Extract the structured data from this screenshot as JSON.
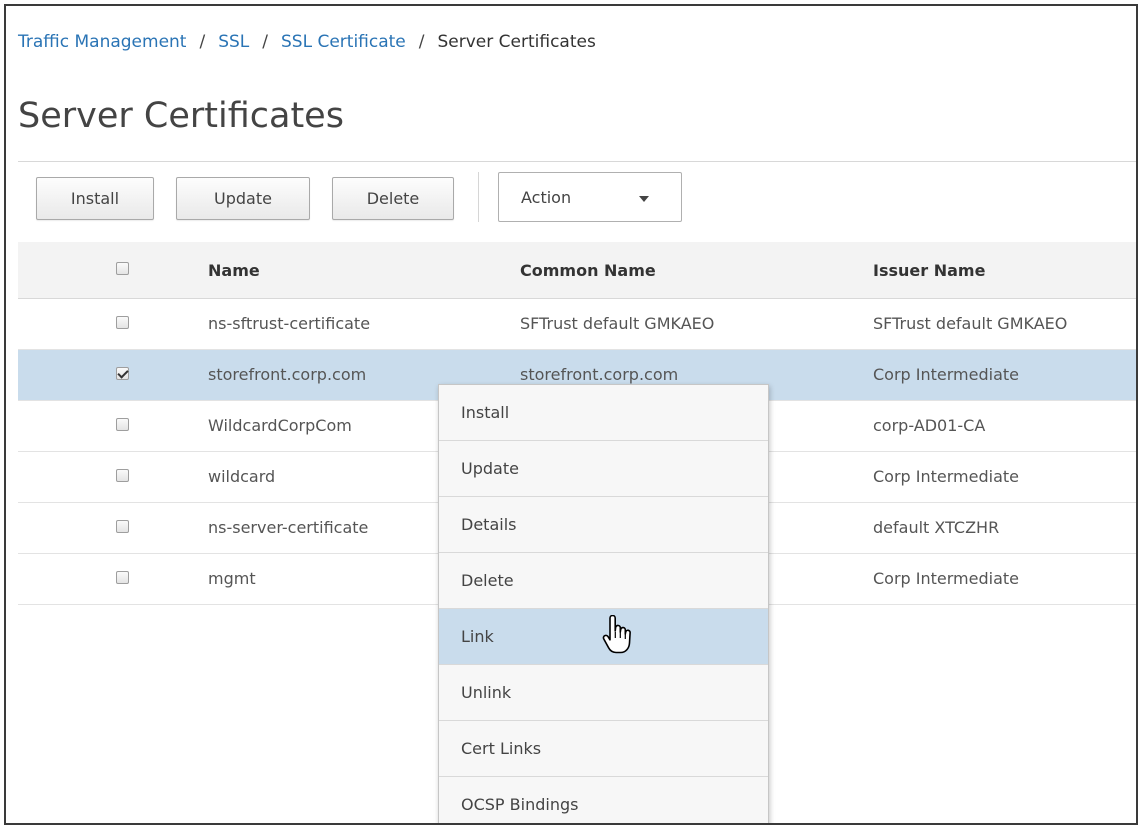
{
  "breadcrumb": {
    "items": [
      "Traffic Management",
      "SSL",
      "SSL Certificate"
    ],
    "separator": "/",
    "current": "Server Certificates"
  },
  "page": {
    "title": "Server Certificates"
  },
  "toolbar": {
    "install_label": "Install",
    "update_label": "Update",
    "delete_label": "Delete",
    "action_label": "Action"
  },
  "table": {
    "headers": {
      "name": "Name",
      "common_name": "Common Name",
      "issuer_name": "Issuer Name"
    },
    "rows": [
      {
        "name": "ns-sftrust-certificate",
        "common_name": "SFTrust default GMKAEO",
        "issuer_name": "SFTrust default GMKAEO",
        "checked": false
      },
      {
        "name": "storefront.corp.com",
        "common_name": "storefront.corp.com",
        "issuer_name": "Corp Intermediate",
        "checked": true
      },
      {
        "name": "WildcardCorpCom",
        "common_name": "",
        "issuer_name": "corp-AD01-CA",
        "checked": false
      },
      {
        "name": "wildcard",
        "common_name": "",
        "issuer_name": "Corp Intermediate",
        "checked": false
      },
      {
        "name": "ns-server-certificate",
        "common_name": "",
        "issuer_name": "default XTCZHR",
        "checked": false
      },
      {
        "name": "mgmt",
        "common_name": "",
        "issuer_name": "Corp Intermediate",
        "checked": false
      }
    ]
  },
  "context_menu": {
    "items": [
      "Install",
      "Update",
      "Details",
      "Delete",
      "Link",
      "Unlink",
      "Cert Links",
      "OCSP Bindings"
    ],
    "hovered": "Link"
  },
  "icons": {
    "cursor": "hand-pointer-icon",
    "dropdown": "caret-down-icon"
  },
  "colors": {
    "link": "#2a74b5",
    "selected_row": "#c9dcec",
    "hover_item": "#c9dcec"
  }
}
